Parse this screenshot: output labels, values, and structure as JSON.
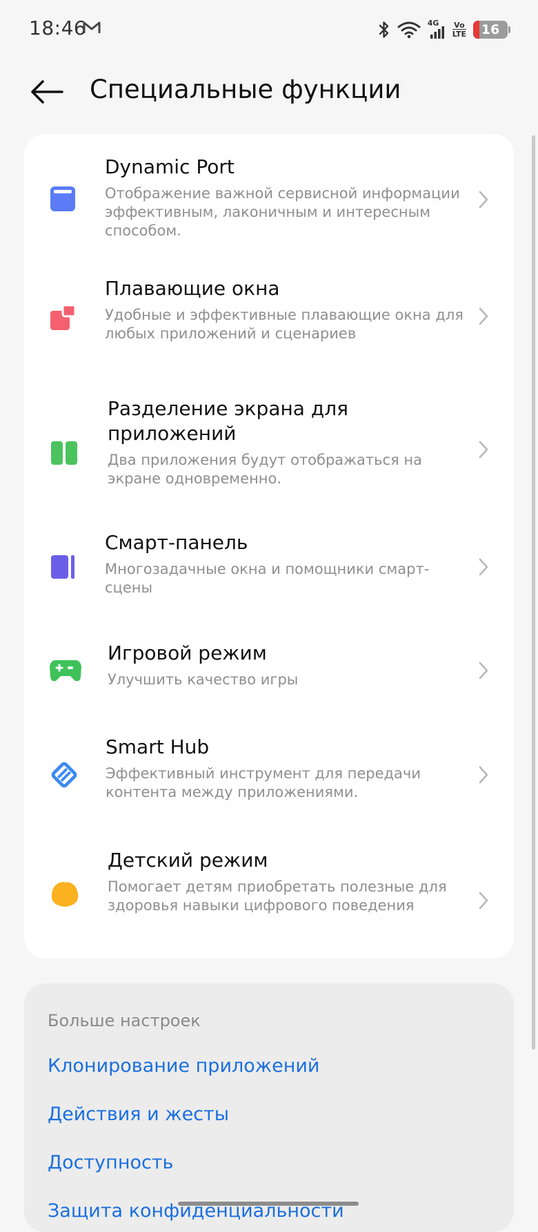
{
  "status_bar": {
    "time": "18:46",
    "network_top": "4G",
    "volte_top": "Vo",
    "volte_bottom": "LTE",
    "battery": "16",
    "icons": [
      "mail-icon",
      "bluetooth-icon",
      "wifi-icon",
      "signal-icon",
      "volte-icon",
      "battery-icon"
    ]
  },
  "header": {
    "back_icon": "back-arrow-icon",
    "title": "Специальные функции"
  },
  "features": [
    {
      "title": "Dynamic Port",
      "desc": "Отображение важной сервисной информации эффективным, лаконичным и интересным способом.",
      "icon": "dynamic-port-icon",
      "color": "#5b7cf6"
    },
    {
      "title": "Плавающие окна",
      "desc": "Удобные и эффективные плавающие окна для любых приложений и сценариев",
      "icon": "floating-windows-icon",
      "color": "#f4606f"
    },
    {
      "title": "Разделение экрана для приложений",
      "desc": "Два приложения будут отображаться на экране одновременно.",
      "icon": "split-screen-icon",
      "color": "#4cc35f"
    },
    {
      "title": "Смарт-панель",
      "desc": "Многозадачные окна и помощники смарт-сцены",
      "icon": "smart-panel-icon",
      "color": "#6b5fe8"
    },
    {
      "title": "Игровой режим",
      "desc": "Улучшить качество игры",
      "icon": "game-mode-icon",
      "color": "#3fc25a"
    },
    {
      "title": "Smart Hub",
      "desc": "Эффективный инструмент для передачи контента между приложениями.",
      "icon": "smart-hub-icon",
      "color": "#3b8af2"
    },
    {
      "title": "Детский режим",
      "desc": "Помогает детям приобретать полезные для здоровья навыки цифрового поведения",
      "icon": "kids-mode-icon",
      "color": "#fbb120"
    }
  ],
  "more_settings": {
    "title": "Больше настроек",
    "links": [
      "Клонирование приложений",
      "Действия и жесты",
      "Доступность",
      "Защита конфиденциальности"
    ]
  },
  "colors": {
    "background": "#f6f6f6",
    "card": "#ffffff",
    "link": "#1a6fe0",
    "secondary_text": "#8f8f8f",
    "chevron": "#b8b8b8"
  }
}
